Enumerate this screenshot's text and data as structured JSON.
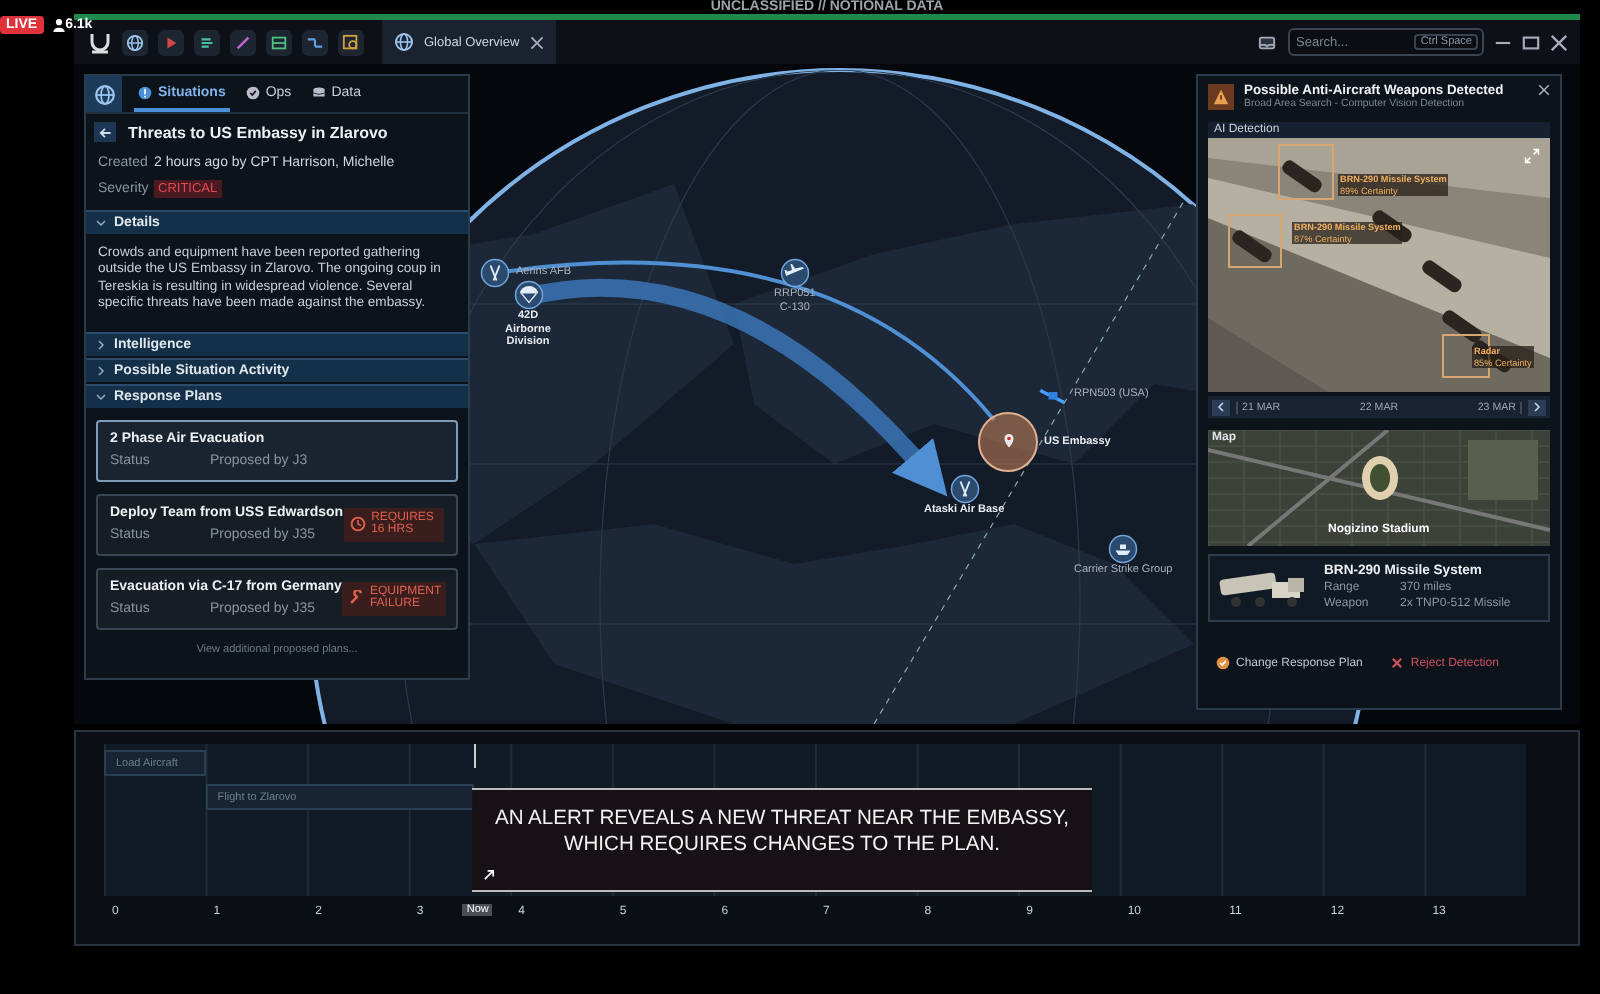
{
  "stream": {
    "live": "LIVE",
    "viewers": "6.1k"
  },
  "classification": "UNCLASSIFIED // NOTIONAL DATA",
  "tab": {
    "label": "Global Overview"
  },
  "search": {
    "placeholder": "Search...",
    "shortcut": "Ctrl Space"
  },
  "situation": {
    "tabs": [
      {
        "label": "Situations",
        "selected": true
      },
      {
        "label": "Ops",
        "selected": false
      },
      {
        "label": "Data",
        "selected": false
      }
    ],
    "title": "Threats to US Embassy in Zlarovo",
    "fields": [
      {
        "label": "Created",
        "value": "2 hours ago by CPT Harrison, Michelle",
        "kind": "text"
      },
      {
        "label": "Severity",
        "value": "CRITICAL",
        "kind": "badge"
      }
    ],
    "sections": [
      {
        "title": "Details",
        "expanded": true,
        "text": "Crowds and equipment have been reported gathering outside the US Embassy in Zlarovo. The ongoing coup in Tereskia is resulting in widespread violence. Several specific threats have been made against the embassy."
      },
      {
        "title": "Intelligence",
        "expanded": false
      },
      {
        "title": "Possible Situation Activity",
        "expanded": false
      },
      {
        "title": "Response Plans",
        "expanded": true,
        "plans": [
          {
            "name": "2 Phase Air Evacuation",
            "status": "Status",
            "proposer": "Proposed by J3",
            "selected": true
          },
          {
            "name": "Deploy Team from USS Edwardson",
            "status": "Status",
            "proposer": "Proposed by J35",
            "selected": false,
            "alert": {
              "kind": "time",
              "text": "REQUIRES 16 HRS"
            }
          },
          {
            "name": "Evacuation via C-17 from Germany",
            "status": "Status",
            "proposer": "Proposed by J35",
            "selected": false,
            "alert": {
              "kind": "failure",
              "text": "EQUIPMENT FAILURE"
            }
          }
        ],
        "more": "View additional proposed plans..."
      }
    ]
  },
  "map": {
    "markers": [
      {
        "kind": "airbase",
        "label": "Aerins AFB"
      },
      {
        "kind": "airborne",
        "label": "42D Airborne Division"
      },
      {
        "kind": "aircraft",
        "label": "RRP051",
        "sublabel": "C-130"
      },
      {
        "kind": "satellite",
        "label": "RPN503 (USA)"
      },
      {
        "kind": "target",
        "label": "US Embassy"
      },
      {
        "kind": "airbase",
        "label": "Ataski Air Base"
      },
      {
        "kind": "ship",
        "label": "Carrier Strike Group"
      }
    ]
  },
  "alert": {
    "title": "Possible Anti-Aircraft Weapons Detected",
    "subtitle": "Broad Area Search - Computer Vision Detection",
    "section": "AI Detection",
    "detections": [
      {
        "label": "BRN-290 Missile System",
        "certainty": "89% Certainty"
      },
      {
        "label": "BRN-290 Missile System",
        "certainty": "87% Certainty"
      },
      {
        "label": "Radar",
        "certainty": "85% Certainty"
      }
    ],
    "dates": [
      "21 MAR",
      "22 MAR",
      "23 MAR"
    ],
    "map": {
      "title": "Map",
      "place": "Nogizino Stadium"
    },
    "weapon": {
      "name": "BRN-290 Missile System",
      "specs": [
        {
          "label": "Range",
          "value": "370 miles"
        },
        {
          "label": "Weapon",
          "value": "2x TNP0-512 Missile"
        }
      ]
    },
    "actions": [
      {
        "kind": "confirm",
        "label": "Change Response Plan"
      },
      {
        "kind": "reject",
        "label": "Reject Detection"
      }
    ]
  },
  "timeline": {
    "ticks": [
      "0",
      "1",
      "2",
      "3",
      "4",
      "5",
      "6",
      "7",
      "8",
      "9",
      "10",
      "11",
      "12",
      "13"
    ],
    "now": "Now",
    "tasks": [
      {
        "label": "Load Aircraft"
      },
      {
        "label": "Flight to Zlarovo"
      }
    ]
  },
  "caption": {
    "text": "AN ALERT REVEALS A NEW THREAT NEAR THE EMBASSY,\nWHICH REQUIRES CHANGES TO THE PLAN."
  }
}
